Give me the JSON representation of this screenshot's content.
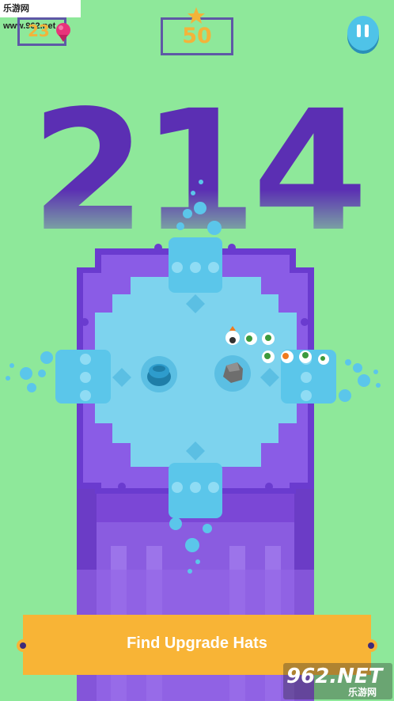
{
  "watermark_top": "乐游网 www.962.net",
  "hud": {
    "gems": "23",
    "score": "50"
  },
  "level": {
    "number": "214"
  },
  "banner": {
    "text": "Find Upgrade Hats"
  },
  "watermark_bottom": {
    "brand": "962.NET",
    "sub": "乐游网"
  },
  "colors": {
    "background": "#8ee89a",
    "purple": "#5b2fb3",
    "water": "#7dd3ee",
    "gold": "#f3b33a",
    "banner": "#f8b436"
  },
  "icons": [
    "gem-icon",
    "star-icon",
    "pause-icon",
    "hole-icon",
    "rock-icon"
  ]
}
